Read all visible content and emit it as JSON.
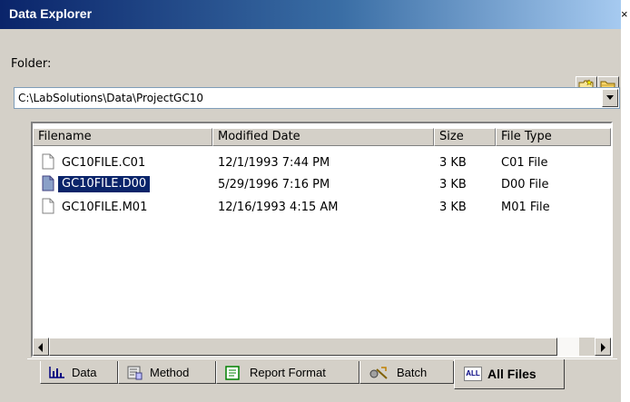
{
  "window": {
    "title": "Data Explorer",
    "close_label": "×"
  },
  "folder": {
    "label": "Folder:",
    "path": "C:\\LabSolutions\\Data\\ProjectGC10"
  },
  "toolbar": {
    "icons": [
      "new-folder-icon",
      "folder-icon"
    ]
  },
  "columns": [
    "Filename",
    "Modified Date",
    "Size",
    "File Type"
  ],
  "files": [
    {
      "name": "GC10FILE.C01",
      "modified": "12/1/1993 7:44 PM",
      "size": "3 KB",
      "type": "C01 File",
      "selected": false
    },
    {
      "name": "GC10FILE.D00",
      "modified": "5/29/1996 7:16 PM",
      "size": "3 KB",
      "type": "D00 File",
      "selected": true
    },
    {
      "name": "GC10FILE.M01",
      "modified": "12/16/1993 4:15 AM",
      "size": "3 KB",
      "type": "M01 File",
      "selected": false
    }
  ],
  "tabs": [
    {
      "label": "Data",
      "icon": "bar-chart-icon",
      "active": false
    },
    {
      "label": "Method",
      "icon": "method-icon",
      "active": false
    },
    {
      "label": "Report Format",
      "icon": "report-icon",
      "active": false
    },
    {
      "label": "Batch",
      "icon": "batch-icon",
      "active": false
    },
    {
      "label": "All Files",
      "icon": "all-files-icon",
      "icon_text": "ALL",
      "active": true
    }
  ],
  "colors": {
    "titlebar_start": "#0a246a",
    "titlebar_end": "#a6caf0",
    "selection": "#0a246a",
    "face": "#d4d0c8"
  }
}
